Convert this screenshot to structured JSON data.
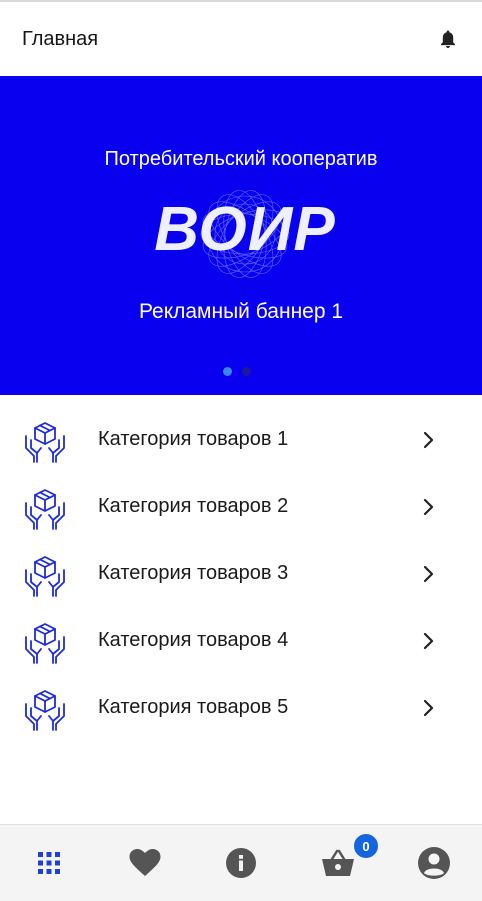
{
  "header": {
    "title": "Главная"
  },
  "banner": {
    "subtitle": "Потребительский кооператив",
    "logo_text": "ВОИР",
    "title": "Рекламный баннер 1",
    "active_slide": 1,
    "slide_count": 2
  },
  "categories": [
    {
      "label": "Категория товаров 1",
      "icon": "box-in-hands-icon"
    },
    {
      "label": "Категория товаров 2",
      "icon": "box-in-hands-icon"
    },
    {
      "label": "Категория товаров 3",
      "icon": "box-in-hands-icon"
    },
    {
      "label": "Категория товаров 4",
      "icon": "box-in-hands-icon"
    },
    {
      "label": "Категория товаров 5",
      "icon": "box-in-hands-icon"
    }
  ],
  "bottom_nav": {
    "items": [
      {
        "icon": "grid-icon",
        "active": true
      },
      {
        "icon": "heart-icon",
        "active": false
      },
      {
        "icon": "info-icon",
        "active": false
      },
      {
        "icon": "basket-icon",
        "active": false
      },
      {
        "icon": "account-icon",
        "active": false
      }
    ],
    "cart_count": "0"
  },
  "colors": {
    "banner_bg": "#0a00f0",
    "accent": "#1565e0",
    "icon_blue": "#1f2bd6",
    "nav_icon": "#555555"
  }
}
